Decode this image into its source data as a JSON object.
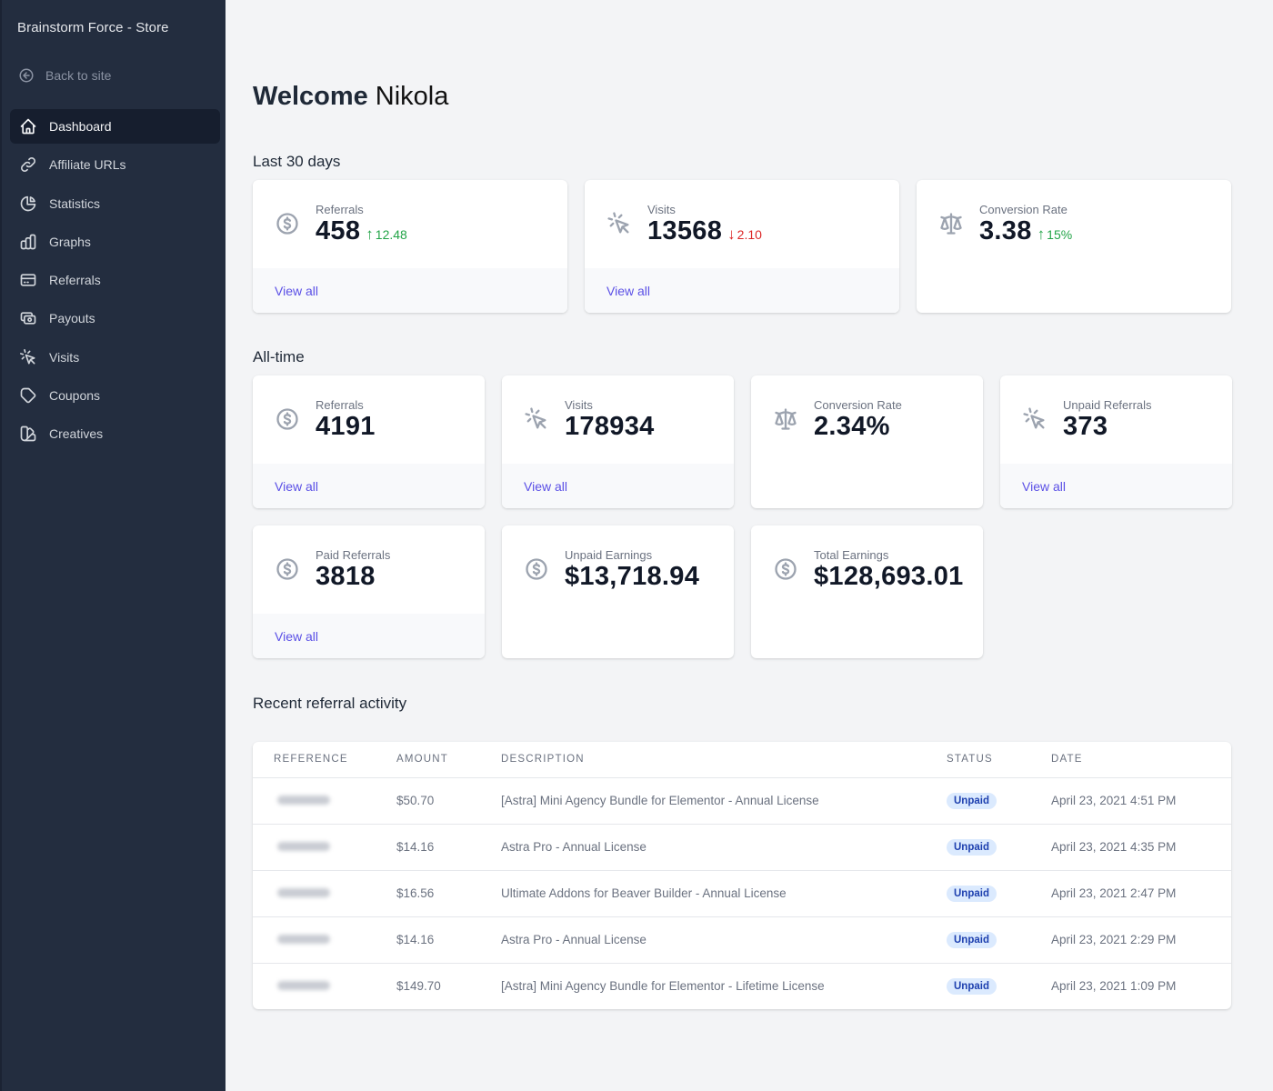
{
  "sidebar": {
    "store_name": "Brainstorm Force - Store",
    "back_label": "Back to site",
    "items": [
      {
        "label": "Dashboard",
        "icon": "home-icon",
        "active": true
      },
      {
        "label": "Affiliate URLs",
        "icon": "link-icon"
      },
      {
        "label": "Statistics",
        "icon": "pie-chart-icon"
      },
      {
        "label": "Graphs",
        "icon": "bar-chart-icon"
      },
      {
        "label": "Referrals",
        "icon": "credit-card-icon"
      },
      {
        "label": "Payouts",
        "icon": "cash-icon"
      },
      {
        "label": "Visits",
        "icon": "cursor-click-icon"
      },
      {
        "label": "Coupons",
        "icon": "tag-icon"
      },
      {
        "label": "Creatives",
        "icon": "color-swatch-icon"
      }
    ]
  },
  "header": {
    "welcome": "Welcome",
    "user_name": "Nikola"
  },
  "last30": {
    "title": "Last 30 days",
    "cards": [
      {
        "label": "Referrals",
        "value": "458",
        "delta": "12.48",
        "delta_dir": "up",
        "icon": "currency-dollar-icon",
        "link": "View all"
      },
      {
        "label": "Visits",
        "value": "13568",
        "delta": "2.10",
        "delta_dir": "down",
        "icon": "cursor-click-icon",
        "link": "View all"
      },
      {
        "label": "Conversion Rate",
        "value": "3.38",
        "delta": "15%",
        "delta_dir": "up",
        "icon": "scale-icon"
      }
    ]
  },
  "alltime": {
    "title": "All-time",
    "cards": [
      {
        "label": "Referrals",
        "value": "4191",
        "icon": "currency-dollar-icon",
        "link": "View all"
      },
      {
        "label": "Visits",
        "value": "178934",
        "icon": "cursor-click-icon",
        "link": "View all"
      },
      {
        "label": "Conversion Rate",
        "value": "2.34%",
        "icon": "scale-icon"
      },
      {
        "label": "Unpaid Referrals",
        "value": "373",
        "icon": "cursor-click-icon",
        "link": "View all"
      },
      {
        "label": "Paid Referrals",
        "value": "3818",
        "icon": "currency-dollar-icon",
        "link": "View all"
      },
      {
        "label": "Unpaid Earnings",
        "value": "$13,718.94",
        "icon": "currency-dollar-icon"
      },
      {
        "label": "Total Earnings",
        "value": "$128,693.01",
        "icon": "currency-dollar-icon"
      }
    ]
  },
  "activity": {
    "title": "Recent referral activity",
    "columns": [
      "REFERENCE",
      "AMOUNT",
      "DESCRIPTION",
      "STATUS",
      "DATE"
    ],
    "rows": [
      {
        "amount": "$50.70",
        "description": "[Astra] Mini Agency Bundle for Elementor - Annual License",
        "status": "Unpaid",
        "date": "April 23, 2021 4:51 PM"
      },
      {
        "amount": "$14.16",
        "description": "Astra Pro - Annual License",
        "status": "Unpaid",
        "date": "April 23, 2021 4:35 PM"
      },
      {
        "amount": "$16.56",
        "description": "Ultimate Addons for Beaver Builder - Annual License",
        "status": "Unpaid",
        "date": "April 23, 2021 2:47 PM"
      },
      {
        "amount": "$14.16",
        "description": "Astra Pro - Annual License",
        "status": "Unpaid",
        "date": "April 23, 2021 2:29 PM"
      },
      {
        "amount": "$149.70",
        "description": "[Astra] Mini Agency Bundle for Elementor - Lifetime License",
        "status": "Unpaid",
        "date": "April 23, 2021 1:09 PM"
      }
    ]
  },
  "colors": {
    "sidebar_bg": "#232d3f",
    "accent_link": "#5b50e6",
    "delta_up": "#22a447",
    "delta_down": "#dc2626",
    "badge_bg": "#dbeafe",
    "badge_text": "#1e40af"
  }
}
